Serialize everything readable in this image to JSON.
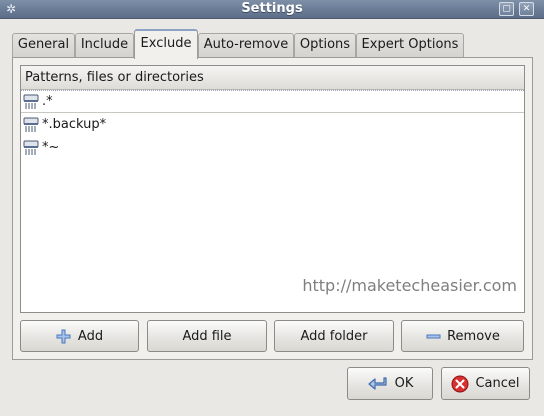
{
  "window": {
    "title": "Settings",
    "app_icon": "gear-icon",
    "maximize_icon": "maximize-icon",
    "close_icon": "close-icon"
  },
  "tabs": [
    {
      "label": "General",
      "active": false
    },
    {
      "label": "Include",
      "active": false
    },
    {
      "label": "Exclude",
      "active": true
    },
    {
      "label": "Auto-remove",
      "active": false
    },
    {
      "label": "Options",
      "active": false
    },
    {
      "label": "Expert Options",
      "active": false
    }
  ],
  "exclude_list": {
    "header": "Patterns, files or directories",
    "rows": [
      {
        "text": ".*",
        "icon": "shredder-icon",
        "selected": true
      },
      {
        "text": "*.backup*",
        "icon": "shredder-icon",
        "selected": false
      },
      {
        "text": "*~",
        "icon": "shredder-icon",
        "selected": false
      }
    ],
    "watermark": "http://maketecheasier.com"
  },
  "actions": {
    "add_label": "Add",
    "add_file_label": "Add file",
    "add_folder_label": "Add folder",
    "remove_label": "Remove"
  },
  "dialog": {
    "ok_label": "OK",
    "cancel_label": "Cancel"
  },
  "colors": {
    "titlebar": "#6a7b95",
    "background": "#e9e8e4",
    "list_background": "#ffffff",
    "active_tab_accent": "#8da3c4",
    "ok_icon": "#5b86c4",
    "cancel_icon": "#cc2222",
    "add_icon": "#4a78c0",
    "remove_icon": "#4a78c0"
  }
}
